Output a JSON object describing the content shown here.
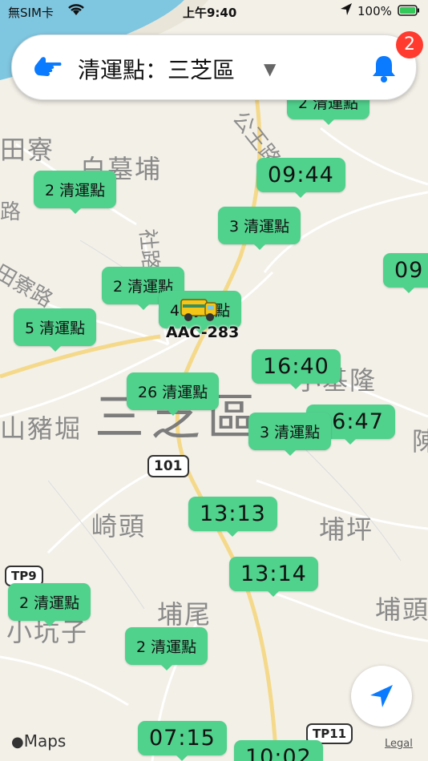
{
  "status_bar": {
    "carrier": "無SIM卡",
    "time": "上午9:40",
    "battery": "100%"
  },
  "search": {
    "title": "清運點：三芝區",
    "notification_count": "2"
  },
  "places": {
    "white_mu_pu": "白墓埔",
    "tian_liao": "田寮",
    "sanzhi": "三芝區",
    "xiao_keelung": "小基隆",
    "zhu_ku": "山豬堀",
    "qi_tou": "崎頭",
    "pu_ping": "埔坪",
    "pu_wei": "埔尾",
    "xiao_keng_zi": "小坑子",
    "pu_tou": "埔頭",
    "chen": "陳"
  },
  "roads": {
    "gong_wang": "公王路",
    "tian_liao_road": "田寮路",
    "lu": "路",
    "she_road": "社路"
  },
  "shields": {
    "r101": "101",
    "tp9": "TP9",
    "tp11": "TP11"
  },
  "pins": [
    {
      "label": "2 清運點"
    },
    {
      "label": "09:44"
    },
    {
      "label": "2 清運點"
    },
    {
      "label": "3 清運點"
    },
    {
      "label": "09"
    },
    {
      "label": "2 清運點"
    },
    {
      "label": "4 清運點"
    },
    {
      "label": "5 清運點"
    },
    {
      "label": "16:40"
    },
    {
      "label": "26 清運點"
    },
    {
      "label": "16:47"
    },
    {
      "label": "3 清運點"
    },
    {
      "label": "13:13"
    },
    {
      "label": "13:14"
    },
    {
      "label": "2 清運點"
    },
    {
      "label": "2 清運點"
    },
    {
      "label": "07:15"
    },
    {
      "label": "10:02"
    }
  ],
  "vehicle": {
    "plate": "AAC-283"
  },
  "footer": {
    "maps": "Maps",
    "legal": "Legal"
  },
  "colors": {
    "pin": "#50d18c",
    "accent_blue": "#0a7aff",
    "badge_red": "#ff3b30"
  }
}
